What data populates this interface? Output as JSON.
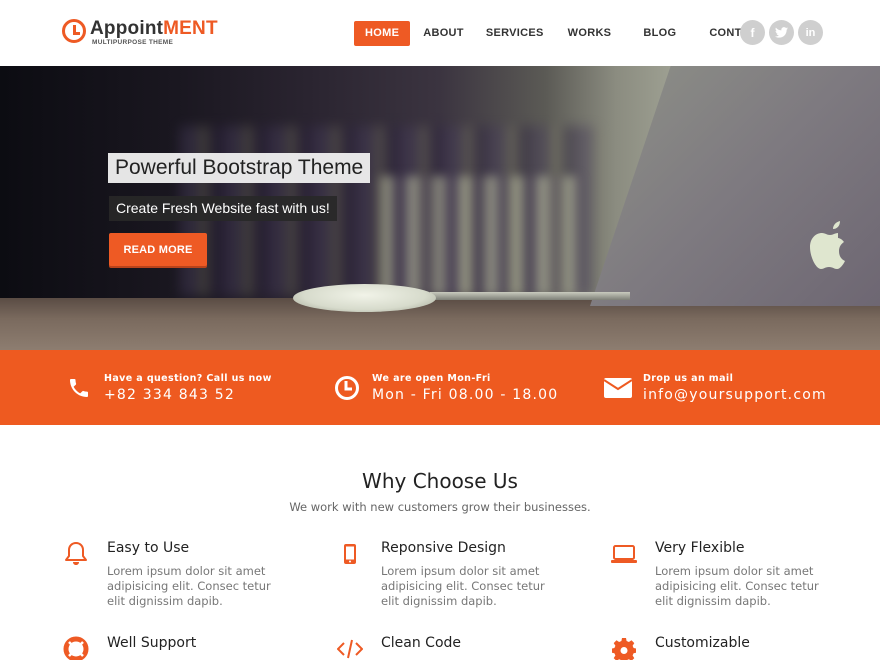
{
  "header": {
    "logo": {
      "name_part1": "Appoint",
      "name_part2": "ment",
      "tagline": "MULTIPURPOSE THEME"
    },
    "nav": [
      {
        "label": "HOME",
        "active": true
      },
      {
        "label": "ABOUT",
        "active": false
      },
      {
        "label": "SERVICES",
        "active": false
      },
      {
        "label": "WORKS",
        "active": false
      },
      {
        "label": "BLOG",
        "active": false
      },
      {
        "label": "CONTACT",
        "active": false
      }
    ],
    "social": [
      {
        "name": "facebook-icon",
        "glyph": "f"
      },
      {
        "name": "twitter-icon",
        "glyph": "t"
      },
      {
        "name": "linkedin-icon",
        "glyph": "in"
      }
    ]
  },
  "hero": {
    "title": "Powerful Bootstrap Theme",
    "subtitle": "Create Fresh Website fast with us!",
    "button_label": "READ MORE"
  },
  "contact_strip": [
    {
      "icon": "phone-icon",
      "label": "Have a question? Call us now",
      "value": "+82 334 843 52"
    },
    {
      "icon": "clock-icon",
      "label": "We are open Mon-Fri",
      "value": "Mon - Fri 08.00 - 18.00"
    },
    {
      "icon": "envelope-icon",
      "label": "Drop us an mail",
      "value": "info@yoursupport.com"
    }
  ],
  "why": {
    "title": "Why Choose Us",
    "subtitle": "We work with new customers grow their businesses.",
    "features": [
      {
        "icon": "bell-icon",
        "title": "Easy to Use",
        "desc": "Lorem ipsum dolor sit amet adipisicing elit. Consec tetur elit dignissim dapib."
      },
      {
        "icon": "mobile-icon",
        "title": "Reponsive Design",
        "desc": "Lorem ipsum dolor sit amet adipisicing elit. Consec tetur elit dignissim dapib."
      },
      {
        "icon": "laptop-icon",
        "title": "Very Flexible",
        "desc": "Lorem ipsum dolor sit amet adipisicing elit. Consec tetur elit dignissim dapib."
      },
      {
        "icon": "life-ring-icon",
        "title": "Well Support",
        "desc": ""
      },
      {
        "icon": "code-icon",
        "title": "Clean Code",
        "desc": ""
      },
      {
        "icon": "gear-icon",
        "title": "Customizable",
        "desc": ""
      }
    ]
  },
  "colors": {
    "accent": "#ee5a24",
    "social_bg": "#cfcfcf",
    "text_dark": "#222222",
    "text_muted": "#777777"
  }
}
